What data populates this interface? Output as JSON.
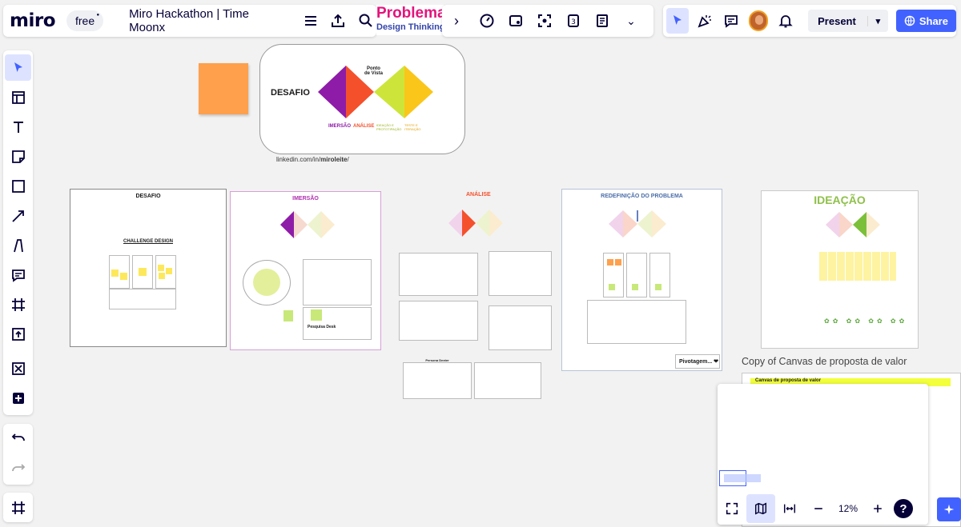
{
  "topbar": {
    "logo": "miro",
    "plan_badge": "free",
    "board_title": "Miro Hackathon | Time Moonx",
    "menu_icon": "hamburger-menu-icon",
    "export_icon": "export-upload-icon",
    "search_icon": "search-icon",
    "present_label": "Present",
    "share_label": "Share"
  },
  "board": {
    "banner": {
      "title": "Problema",
      "subtitle": "Design Thinking"
    },
    "hero": {
      "desafio": "DESAFIO",
      "ponto_de_vista": "Ponto\nde Vista",
      "phase_imersao": "IMERSÃO",
      "phase_analise": "ANÁLISE",
      "phase_ideacao": "IDEAÇÃO E PROTOTIPAÇÃO",
      "phase_testes": "TESTE E ITERAÇÃO",
      "link_prefix": "linkedin.com/in/",
      "link_handle": "miroleite",
      "link_suffix": "/"
    },
    "frames": {
      "desafio": "DESAFIO",
      "challenge": "CHALLENGE DESIGN",
      "imersao": "IMERSÃO",
      "pesquisa": "Pesquisa Desk",
      "analise": "ANÁLISE",
      "persona": "Persona Dexter",
      "redefinicao": "REDEFINIÇÃO DO PROBLEMA",
      "pivotagem": "Pivotagem... ❤",
      "ideacao": "IDEAÇÃO",
      "copy_canvas": "Copy of Canvas de proposta de valor",
      "canvas_header": "Canvas de proposta de valor"
    }
  },
  "minimap": {
    "zoom": "12%",
    "help": "?"
  },
  "colors": {
    "accent": "#4262ff",
    "brand_dark": "#050038",
    "purple": "#8e1ca8",
    "orange_red": "#f4502c",
    "lime": "#cde53a",
    "yellow": "#fbc61a",
    "sticky_yellow": "#fde85b",
    "banner_pink": "#e4147c"
  }
}
